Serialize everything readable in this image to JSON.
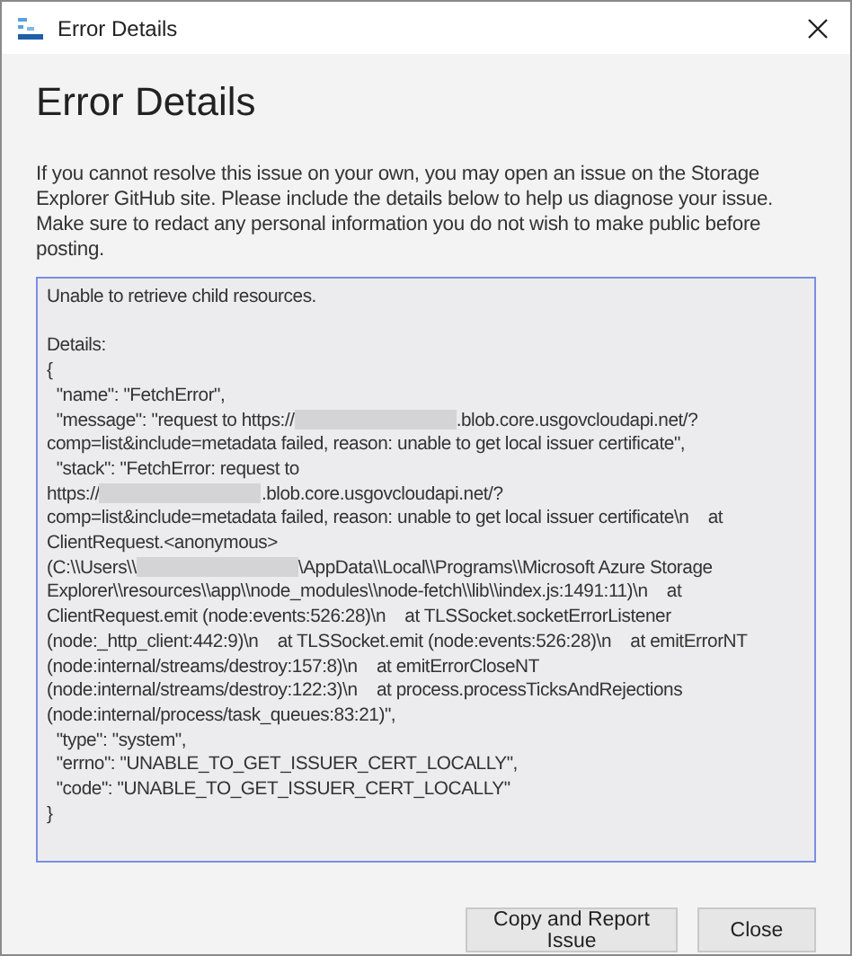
{
  "window": {
    "title": "Error Details"
  },
  "heading": "Error Details",
  "intro": "If you cannot resolve this issue on your own, you may open an issue on the Storage Explorer GitHub site. Please include the details below to help us diagnose your issue. Make sure to redact any personal information you do not wish to make public before posting.",
  "details": {
    "summary": "Unable to retrieve child resources.",
    "lines": [
      [
        {
          "kind": "text",
          "text": "Details:"
        }
      ],
      [
        {
          "kind": "text",
          "text": "{"
        }
      ],
      [
        {
          "kind": "text",
          "text": "  \"name\": \"FetchError\","
        }
      ],
      [
        {
          "kind": "text",
          "text": "  \"message\": \"request to https://"
        },
        {
          "kind": "redacted"
        },
        {
          "kind": "text",
          "text": ".blob.core.usgovcloudapi.net/?"
        }
      ],
      [
        {
          "kind": "text",
          "text": "comp=list&include=metadata failed, reason: unable to get local issuer certificate\","
        }
      ],
      [
        {
          "kind": "text",
          "text": "  \"stack\": \"FetchError: request to"
        }
      ],
      [
        {
          "kind": "text",
          "text": "https://"
        },
        {
          "kind": "redacted"
        },
        {
          "kind": "text",
          "text": ".blob.core.usgovcloudapi.net/?"
        }
      ],
      [
        {
          "kind": "text",
          "text": "comp=list&include=metadata failed, reason: unable to get local issuer certificate\\n    at"
        }
      ],
      [
        {
          "kind": "text",
          "text": "ClientRequest.<anonymous>"
        }
      ],
      [
        {
          "kind": "text",
          "text": "(C:\\\\Users\\\\"
        },
        {
          "kind": "redacted"
        },
        {
          "kind": "text",
          "text": "\\AppData\\\\Local\\\\Programs\\\\Microsoft Azure Storage"
        }
      ],
      [
        {
          "kind": "text",
          "text": "Explorer\\\\resources\\\\app\\\\node_modules\\\\node-fetch\\\\lib\\\\index.js:1491:11)\\n    at"
        }
      ],
      [
        {
          "kind": "text",
          "text": "ClientRequest.emit (node:events:526:28)\\n    at TLSSocket.socketErrorListener"
        }
      ],
      [
        {
          "kind": "text",
          "text": "(node:_http_client:442:9)\\n    at TLSSocket.emit (node:events:526:28)\\n    at emitErrorNT"
        }
      ],
      [
        {
          "kind": "text",
          "text": "(node:internal/streams/destroy:157:8)\\n    at emitErrorCloseNT"
        }
      ],
      [
        {
          "kind": "text",
          "text": "(node:internal/streams/destroy:122:3)\\n    at process.processTicksAndRejections"
        }
      ],
      [
        {
          "kind": "text",
          "text": "(node:internal/process/task_queues:83:21)\","
        }
      ],
      [
        {
          "kind": "text",
          "text": "  \"type\": \"system\","
        }
      ],
      [
        {
          "kind": "text",
          "text": "  \"errno\": \"UNABLE_TO_GET_ISSUER_CERT_LOCALLY\","
        }
      ],
      [
        {
          "kind": "text",
          "text": "  \"code\": \"UNABLE_TO_GET_ISSUER_CERT_LOCALLY\""
        }
      ],
      [
        {
          "kind": "text",
          "text": "}"
        }
      ]
    ]
  },
  "buttons": [
    "Copy and Report Issue",
    "Close"
  ]
}
